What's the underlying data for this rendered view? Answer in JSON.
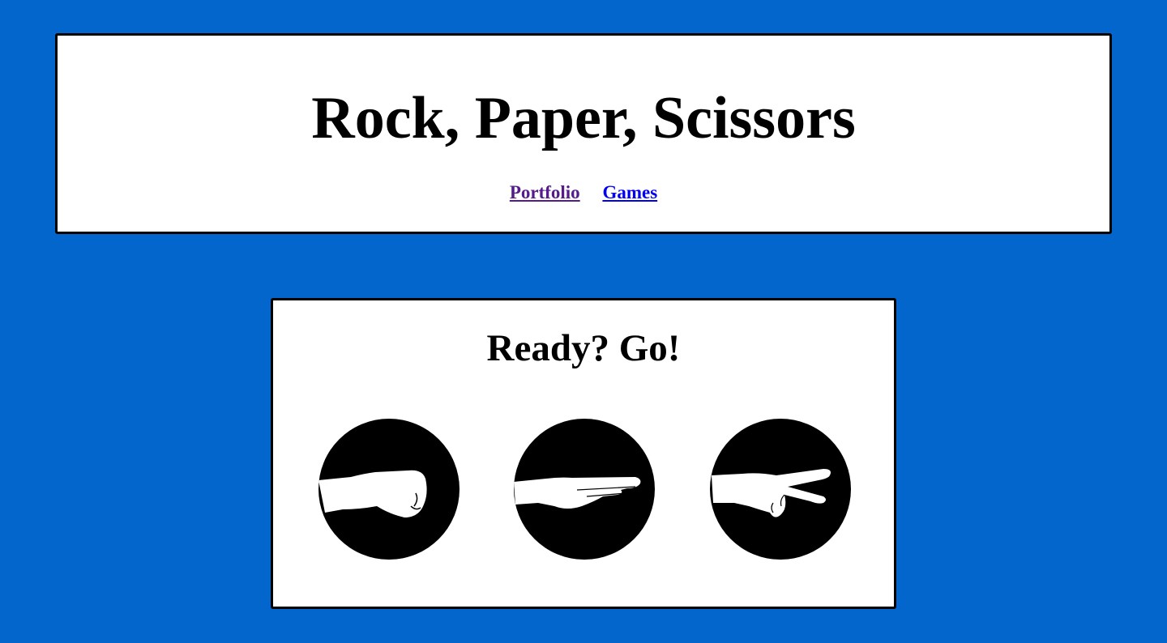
{
  "header": {
    "title": "Rock, Paper, Scissors",
    "nav": [
      {
        "label": "Portfolio",
        "state": "visited"
      },
      {
        "label": "Games",
        "state": "unvisited"
      }
    ]
  },
  "game": {
    "heading": "Ready? Go!",
    "choices": [
      {
        "id": "rock",
        "icon": "rock-hand-icon"
      },
      {
        "id": "paper",
        "icon": "paper-hand-icon"
      },
      {
        "id": "scissors",
        "icon": "scissors-hand-icon"
      }
    ]
  },
  "colors": {
    "background": "#0366cc",
    "panel": "#ffffff",
    "border": "#000000",
    "link_visited": "#551a8b",
    "link_unvisited": "#0000ee"
  }
}
